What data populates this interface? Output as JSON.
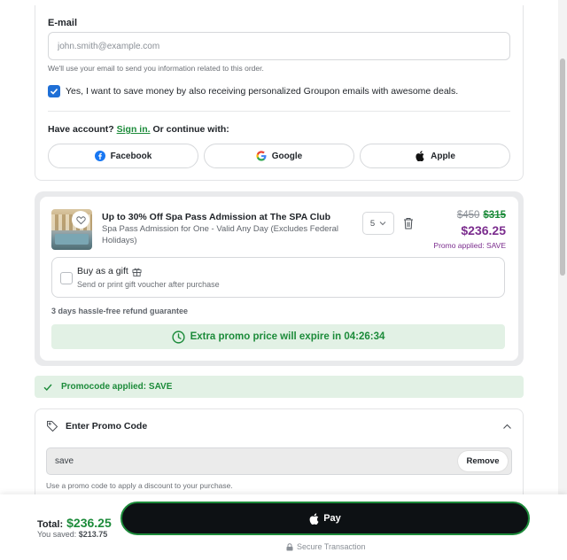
{
  "contact": {
    "email_label": "E-mail",
    "email_placeholder": "john.smith@example.com",
    "email_hint": "We'll use your email to send you information related to this order.",
    "optin_text": "Yes, I want to save money by also receiving personalized Groupon emails with awesome deals.",
    "optin_checked": true,
    "account_prefix": "Have account?",
    "signin_link": "Sign in.",
    "account_suffix": "Or continue with:",
    "social_buttons": [
      {
        "label": "Facebook",
        "icon": "facebook-icon"
      },
      {
        "label": "Google",
        "icon": "google-icon"
      },
      {
        "label": "Apple",
        "icon": "apple-icon"
      }
    ]
  },
  "deal": {
    "title": "Up to 30% Off Spa Pass Admission at The SPA Club",
    "subtitle": "Spa Pass Admission for One - Valid Any Day (Excludes Federal Holidays)",
    "quantity": "5",
    "price_original_1": "$450",
    "price_original_2": "$315",
    "price_current": "$236.25",
    "promo_applied": "Promo applied: SAVE",
    "gift_title": "Buy as a gift",
    "gift_subtitle": "Send or print gift voucher after purchase",
    "refund_text": "3 days hassle-free refund guarantee",
    "expire_text": "Extra promo price will expire in 04:26:34"
  },
  "promo_banner": {
    "text": "Promocode applied: SAVE"
  },
  "promo_section": {
    "heading": "Enter Promo Code",
    "code_value": "save",
    "remove_label": "Remove",
    "help_text": "Use a promo code to apply a discount to your purchase."
  },
  "checkout_bar": {
    "total_label": "Total:",
    "total_amount": "$236.25",
    "saved_label": "You saved:",
    "saved_amount": "$213.75",
    "pay_label": "Pay",
    "secure_text": "Secure Transaction"
  },
  "colors": {
    "green": "#1c8b3a",
    "purple": "#7b2d8e",
    "checkbox_blue": "#1f6fd6",
    "pay_black": "#0d1114"
  }
}
